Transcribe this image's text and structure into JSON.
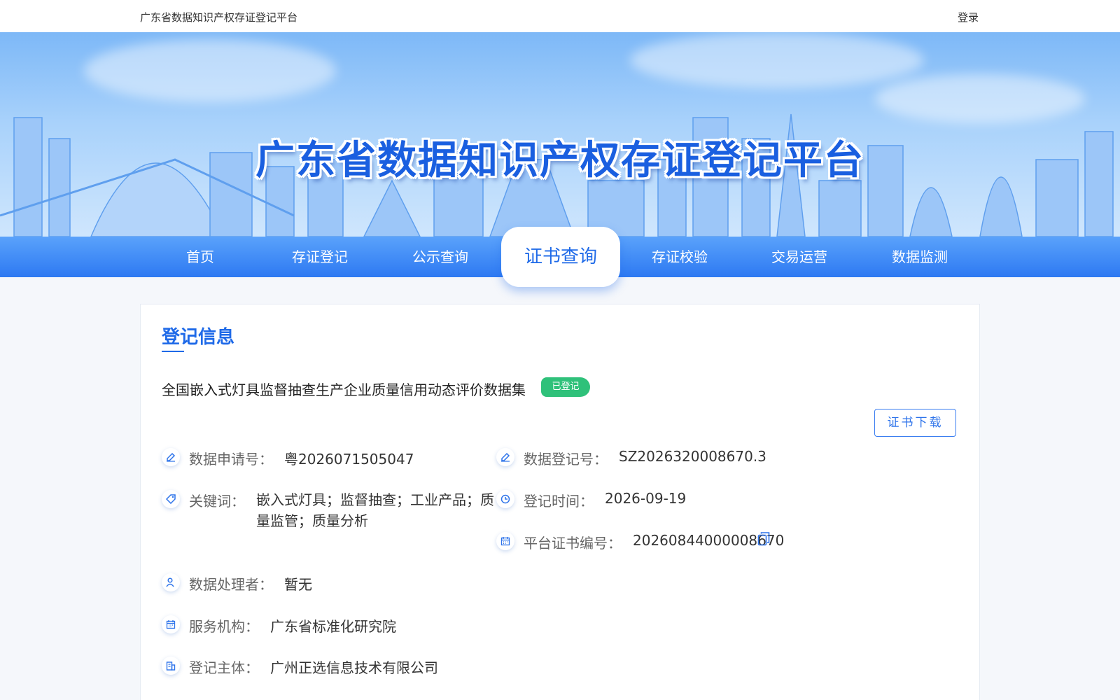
{
  "topbar": {
    "site_name": "广东省数据知识产权存证登记平台",
    "login": "登录"
  },
  "banner": {
    "title": "广东省数据知识产权存证登记平台"
  },
  "nav": {
    "items": [
      "首页",
      "存证登记",
      "公示查询",
      "证书查询",
      "存证校验",
      "交易运营",
      "数据监测"
    ],
    "active": "证书查询"
  },
  "record": {
    "section_title": "登记信息",
    "dataset_name": "全国嵌入式灯具监督抽查生产企业质量信用动态评价数据集",
    "status": "已登记",
    "download_label": "证书下载",
    "fields": {
      "application_no": {
        "label": "数据申请号：",
        "value": "粤2026071505047",
        "icon": "edit-icon"
      },
      "registration_no": {
        "label": "数据登记号：",
        "value": "SZ2026320008670.3",
        "icon": "edit-icon"
      },
      "keywords": {
        "label": "关键词：",
        "value": "嵌入式灯具；监督抽查；工业产品；质量监管；质量分析",
        "icon": "tag-icon"
      },
      "registration_time": {
        "label": "登记时间：",
        "value": "2026-09-19",
        "icon": "clock-icon"
      },
      "certificate_no": {
        "label": "平台证书编号：",
        "value": "20260844000008670",
        "icon": "calendar-icon"
      },
      "processor": {
        "label": "数据处理者：",
        "value": "暂无",
        "icon": "user-icon"
      },
      "service_org": {
        "label": "服务机构：",
        "value": "广东省标准化研究院",
        "icon": "calendar-icon"
      },
      "registrant": {
        "label": "登记主体：",
        "value": "广州正选信息技术有限公司",
        "icon": "building-icon"
      }
    }
  },
  "colors": {
    "brand": "#1f6ae8",
    "nav_bg": "#3b86f5",
    "status_green": "#2fc17a"
  }
}
